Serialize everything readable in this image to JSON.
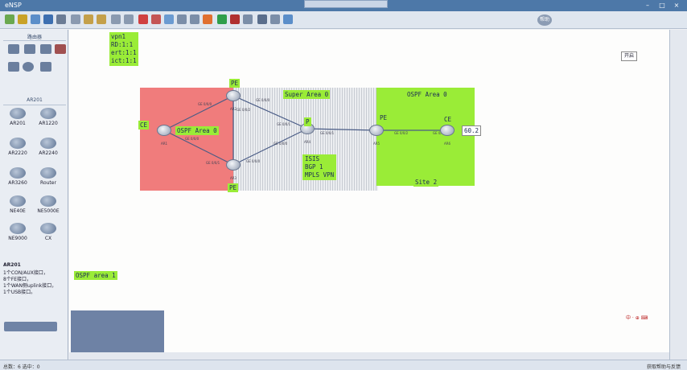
{
  "app": {
    "title": "eNSP"
  },
  "window_controls": [
    "–",
    "□",
    "×"
  ],
  "toolbar": {
    "help_label": "帮助"
  },
  "left_panel": {
    "section1_title": "路由器",
    "section2_title": "AR201",
    "devices": [
      "AR201",
      "AR1220",
      "AR2220",
      "AR2240",
      "AR3260",
      "Router",
      "NE40E",
      "NE5000E",
      "NE9000",
      "CX"
    ],
    "desc_title": "AR201",
    "desc_lines": [
      "1个CON/AUX接口，",
      "8个FE接口，",
      "1个WAN侧uplink接口，",
      "1个USB接口。"
    ]
  },
  "canvas": {
    "vpn_note": [
      "vpn1",
      "RD:1:1",
      "ert:1:1",
      "ict:1:1"
    ],
    "grid_button": "开启",
    "labels": {
      "pe_top": "PE",
      "pe_bottom": "PE",
      "pe_right": "PE",
      "ce_left": "CE",
      "ce_right": "CE",
      "p_mid": "P",
      "ospf_area0_left": "OSPF Area 0",
      "super_area0": "Super Area 0",
      "ospf_area0_right": "OSPF Area 0",
      "site2": "Site 2",
      "ip": "60.2",
      "ospf_area1": "OSPF area 1"
    },
    "tech_note": [
      "ISIS",
      "BGP 1",
      "MPLS VPN"
    ],
    "router_names": {
      "ce_left": "AR1",
      "pe_top": "AR2",
      "pe_bottom": "AR3",
      "p_mid": "AR4",
      "pe_right": "AR5",
      "ce_right": "AR6"
    },
    "link_labels": [
      "GE 0/0/0",
      "GE 0/0/1",
      "GE 0/0/0",
      "GE 0/0/1",
      "GE 0/0/2",
      "GE 0/0/0",
      "GE 0/0/1",
      "GE 0/0/0",
      "GE 0/0/0",
      "GE 0/0/1",
      "GE 0/0/2",
      "GE 0/0/0"
    ]
  },
  "statusbar": {
    "left": "总数：6 选中：0",
    "right": "获取帮助与反馈"
  },
  "input_method": {
    "label": "中 · ⊕ ⌨"
  }
}
